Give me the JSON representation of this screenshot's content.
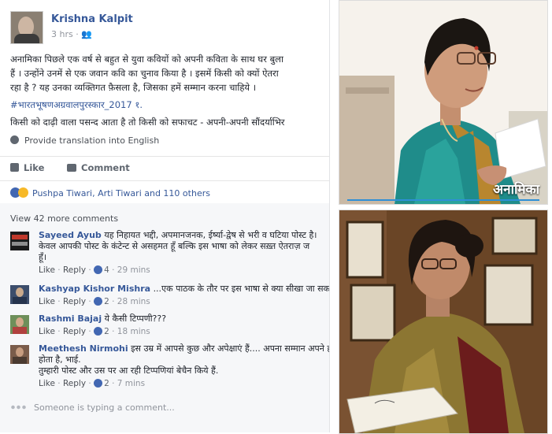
{
  "post": {
    "author": "Krishna Kalpit",
    "time": "3 hrs · 👥",
    "lines": [
      "अनामिका पिछले एक वर्ष से बहुत से युवा कवियों को अपनी कविता के साथ घर बुला",
      "हैं । उन्होंने उनमें से एक जवान कवि का चुनाव किया है । इसमें किसी को क्यों ऐतरा",
      "रहा है ? यह उनका व्यक्तिगत फ़ैसला है, जिसका हमें सम्मान करना चाहिये ।"
    ],
    "hashtag": "#भारतभूषणअग्रवालपुरस्कार_2017 १.",
    "line2": "किसी को दाढ़ी वाला पसन्द आता है तो किसी को सफाचट - अपनी-अपनी सौंदर्याभिर",
    "translate": "Provide translation into English",
    "actions": {
      "like": "Like",
      "comment": "Comment"
    },
    "reactions": "Pushpa Tiwari, Arti Tiwari and 110 others"
  },
  "comments_area": {
    "view_more": "View 42 more comments",
    "comments": [
      {
        "name": "Sayeed Ayub",
        "text": [
          "यह निहायत भद्दी, अपमानजनक, ईर्ष्या-द्वेष से भरी व घटिया पोस्ट है।",
          "केवल आपकी पोस्ट के कंटेन्ट से असहमत हूँ बल्कि इस भाषा को लेकर सख़्त ऐतराज़ ज",
          "हूँ।"
        ],
        "like": "Like",
        "reply": "Reply",
        "count": "4",
        "time": "29 mins"
      },
      {
        "name": "Kashyap Kishor Mishra",
        "text": [
          "...एक पाठक के तौर पर इस भाषा से क्या सीखा जा सकता"
        ],
        "like": "Like",
        "reply": "Reply",
        "count": "2",
        "time": "28 mins"
      },
      {
        "name": "Rashmi Bajaj",
        "text": [
          "ये कैसी टिप्पणी???"
        ],
        "like": "Like",
        "reply": "Reply",
        "count": "2",
        "time": "18 mins"
      },
      {
        "name": "Meethesh Nirmohi",
        "text": [
          "इस उम्र में आपसे कुछ और अपेक्षाएं हैं.... अपना सम्मान अपने हा",
          "होता है, भाई.",
          "तुम्हारी पोस्ट और उस पर आ रही टिप्पणियां बेचैन किये हैं."
        ],
        "like": "Like",
        "reply": "Reply",
        "count": "2",
        "time": "7 mins"
      }
    ],
    "typing": "Someone is typing a comment..."
  },
  "photos": {
    "caption": "अनामिका"
  }
}
